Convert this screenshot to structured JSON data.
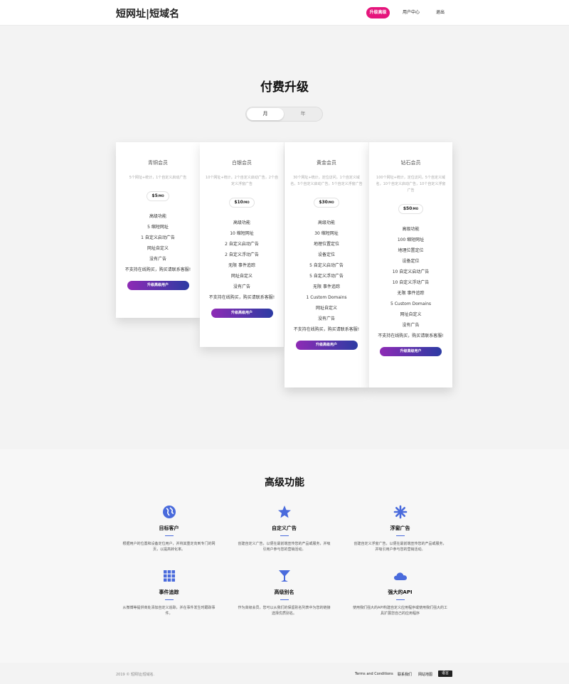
{
  "header": {
    "logo": "短网址|短域名",
    "upgrade_label": "升级高级",
    "user_center_label": "用户中心",
    "logout_label": "退出"
  },
  "pricing": {
    "title": "付费升级",
    "toggle_month": "月",
    "toggle_year": "年",
    "plans": [
      {
        "name": "青铜会员",
        "desc": "5个网址+统计，1个自定义启动广告",
        "price": "$5",
        "period": "/MO",
        "features": [
          "高级功能",
          "5 缩短网址",
          "1 自定义启动广告",
          "网址自定义",
          "没有广告",
          "不支持在线购买，购买请联系客服!"
        ],
        "button": "升级高级用户"
      },
      {
        "name": "白银会员",
        "desc": "10个网址+统计，2个自定义启动广告，2个自定义浮窗广告",
        "price": "$10",
        "period": "/MO",
        "features": [
          "高级功能",
          "10 缩短网址",
          "2 自定义启动广告",
          "2 自定义浮动广告",
          "无限 事件追踪",
          "网址自定义",
          "没有广告",
          "不支持在线购买，购买请联系客服!"
        ],
        "button": "升级高级用户"
      },
      {
        "name": "黄金会员",
        "desc": "30个网址+统计，定位访问，1个自定义域名，5个自定义启动广告，5个自定义浮窗广告",
        "price": "$30",
        "period": "/MO",
        "features": [
          "高级功能",
          "30 缩短网址",
          "地理位置定位",
          "设备定位",
          "5 自定义启动广告",
          "5 自定义浮动广告",
          "无限 事件追踪",
          "1 Custom Domains",
          "网址自定义",
          "没有广告",
          "不支持在线购买，购买请联系客服!"
        ],
        "button": "升级高级用户"
      },
      {
        "name": "钻石会员",
        "desc": "100个网址+统计，定位访问，5个自定义域名，10个自定义启动广告，10个自定义浮窗广告",
        "price": "$50",
        "period": "/MO",
        "features": [
          "高级功能",
          "100 缩短网址",
          "地理位置定位",
          "设备定位",
          "10 自定义启动广告",
          "10 自定义浮动广告",
          "无限 事件追踪",
          "5 Custom Domains",
          "网址自定义",
          "没有广告",
          "不支持在线购买，购买请联系客服!"
        ],
        "button": "升级高级用户"
      }
    ]
  },
  "features": {
    "title": "高级功能",
    "icon_color": "#4a6bdc",
    "items": [
      {
        "icon": "globe-icon",
        "title": "目标客户",
        "text": "根据用户的位置和设备定位用户，并将其重定向到专门的网页，以提高转化率。"
      },
      {
        "icon": "star-icon",
        "title": "自定义广告",
        "text": "创建自定义广告，以便在最前端宣传您的产品或服务，并吸引用户参与您的营销活动。"
      },
      {
        "icon": "asterisk-icon",
        "title": "浮窗广告",
        "text": "创建自定义浮窗广告，以便在最前端宣传您的产品或服务，并吸引用户参与您的营销活动。"
      },
      {
        "icon": "grid-icon",
        "title": "事件追踪",
        "text": "从微博等提供商处添加自定义追踪，并在事件发生时跟踪事件。"
      },
      {
        "icon": "cocktail-icon",
        "title": "高级别名",
        "text": "作为高级会员，您可以从我们的保留别名列表中为您的链接选择优质别名。"
      },
      {
        "icon": "cloud-icon",
        "title": "强大的API",
        "text": "使用我们强大的API构建自定义应用程序或使用我们强大的工具扩展您自己的应用程序"
      }
    ]
  },
  "footer": {
    "copyright": "2019 © 短网址|短域名.",
    "terms": "Terms and Conditions",
    "contact": "联系我们",
    "sitemap": "网站地图",
    "language": "语言"
  }
}
